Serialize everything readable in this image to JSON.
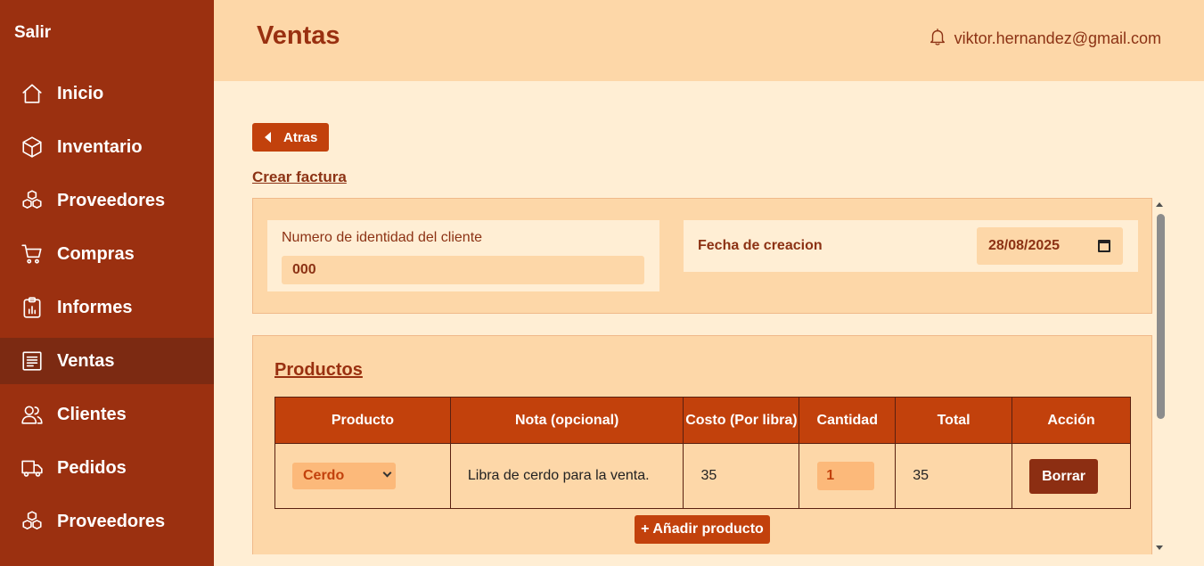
{
  "sidebar": {
    "logout_label": "Salir",
    "items": [
      {
        "label": "Inicio",
        "icon": "home-icon"
      },
      {
        "label": "Inventario",
        "icon": "box-icon"
      },
      {
        "label": "Proveedores",
        "icon": "boxes-icon"
      },
      {
        "label": "Compras",
        "icon": "cart-icon"
      },
      {
        "label": "Informes",
        "icon": "report-icon"
      },
      {
        "label": "Ventas",
        "icon": "receipt-icon",
        "active": true
      },
      {
        "label": "Clientes",
        "icon": "users-icon"
      },
      {
        "label": "Pedidos",
        "icon": "truck-icon"
      },
      {
        "label": "Proveedores",
        "icon": "boxes-icon"
      }
    ]
  },
  "header": {
    "title": "Ventas",
    "user_email": "viktor.hernandez@gmail.com"
  },
  "main": {
    "back_label": "Atras",
    "section_link": "Crear factura",
    "client_id_label": "Numero de identidad del cliente",
    "client_id_value": "000",
    "date_label": "Fecha de creacion",
    "date_value": "28/08/2025",
    "products_title": "Productos",
    "table": {
      "headers": [
        "Producto",
        "Nota (opcional)",
        "Costo (Por libra)",
        "Cantidad",
        "Total",
        "Acción"
      ],
      "rows": [
        {
          "producto": "Cerdo",
          "nota": "Libra de cerdo para la venta.",
          "costo": "35",
          "cantidad": "1",
          "total": "35",
          "accion": "Borrar"
        }
      ]
    },
    "add_product_label": "+ Añadir producto"
  },
  "colors": {
    "sidebar_bg": "#9b3010",
    "sidebar_active": "#7c2a12",
    "header_bg": "#fdd7a8",
    "page_bg": "#ffeed4",
    "accent": "#c2410c",
    "text_brown": "#8c3214"
  }
}
